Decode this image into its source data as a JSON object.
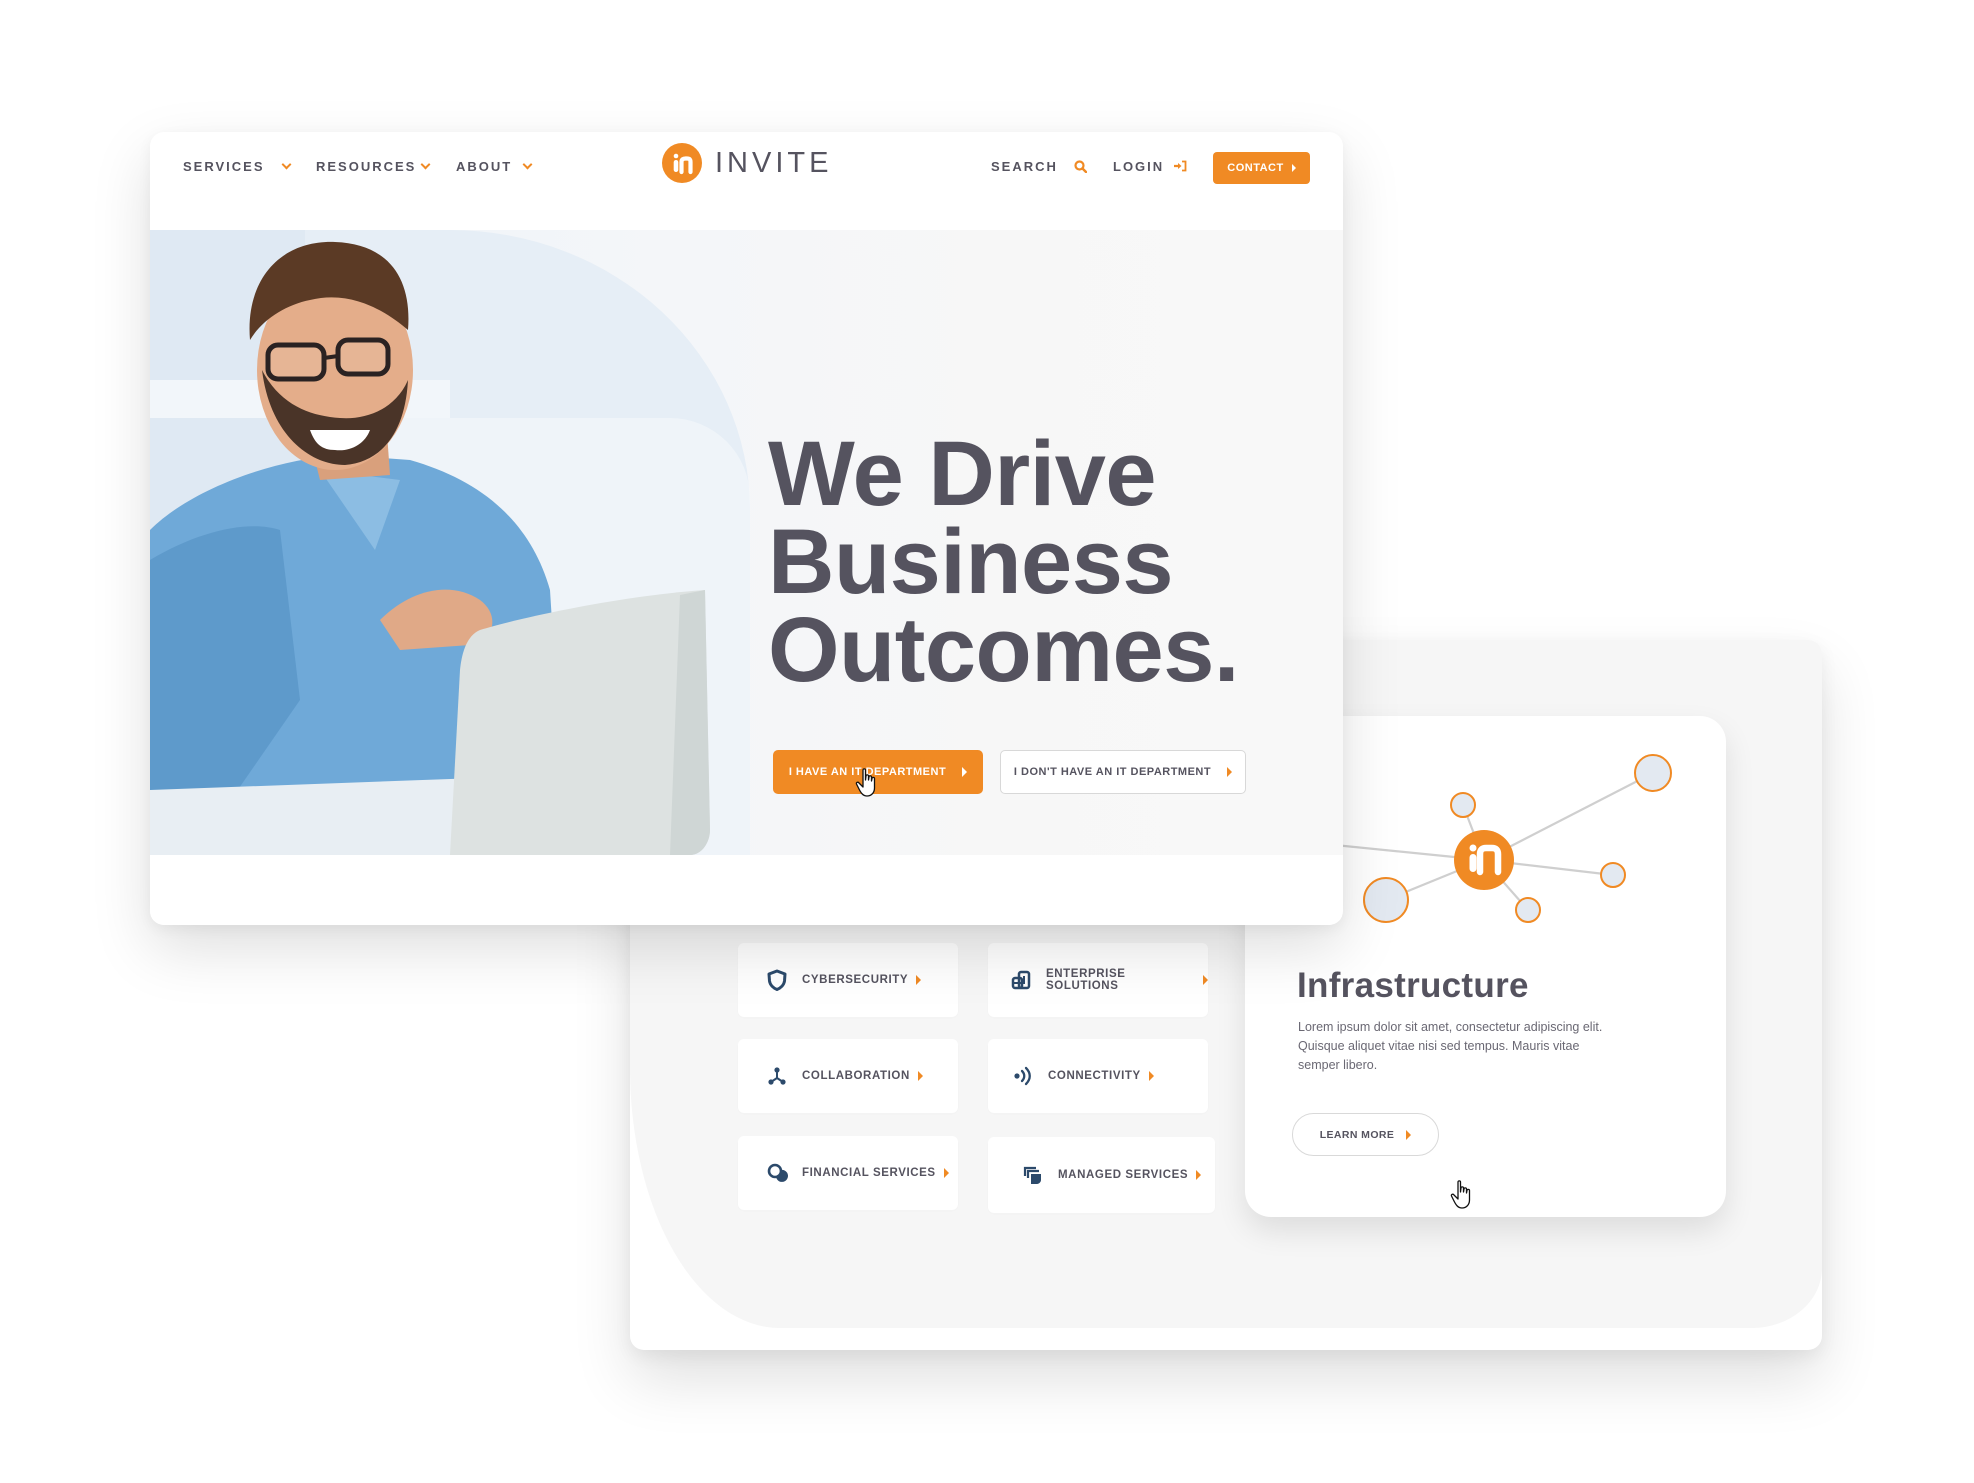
{
  "colors": {
    "accent": "#f08a24",
    "text": "#55535f",
    "icon": "#2c4a6b",
    "node_fill": "#e3e9f1",
    "line": "#cfcfcf"
  },
  "front_page": {
    "nav": {
      "left_items": [
        {
          "label": "SERVICES",
          "icon": "chevron-down-icon"
        },
        {
          "label": "RESOURCES",
          "icon": "chevron-down-icon"
        },
        {
          "label": "ABOUT",
          "icon": "chevron-down-icon"
        }
      ],
      "logo_text": "INVITE",
      "logo_icon": "invite-logo-icon",
      "search_label": "SEARCH",
      "search_icon": "search-icon",
      "login_label": "LOGIN",
      "login_icon": "login-icon",
      "contact_label": "CONTACT"
    },
    "hero": {
      "headline_lines": [
        "We Drive",
        "Business",
        "Outcomes."
      ],
      "primary_cta": "I HAVE AN IT DEPARTMENT",
      "secondary_cta": "I DON'T HAVE AN IT DEPARTMENT",
      "image": "smiling-man-with-laptop-photo"
    }
  },
  "services_page": {
    "tiles": [
      {
        "label": "CYBERSECURITY",
        "icon": "shield-icon"
      },
      {
        "label": "ENTERPRISE SOLUTIONS",
        "icon": "enterprise-building-icon"
      },
      {
        "label": "COLLABORATION",
        "icon": "network-nodes-icon"
      },
      {
        "label": "CONNECTIVITY",
        "icon": "signal-waves-icon"
      },
      {
        "label": "FINANCIAL SERVICES",
        "icon": "coins-icon"
      },
      {
        "label": "MANAGED SERVICES",
        "icon": "layers-icon"
      }
    ],
    "featured": {
      "title": "Infrastructure",
      "description": "Lorem ipsum dolor sit amet, consectetur adipiscing elit. Quisque aliquet vitae nisi sed tempus. Mauris vitae semper libero.",
      "cta": "LEARN MORE",
      "diagram_icon": "network-diagram-icon"
    }
  }
}
